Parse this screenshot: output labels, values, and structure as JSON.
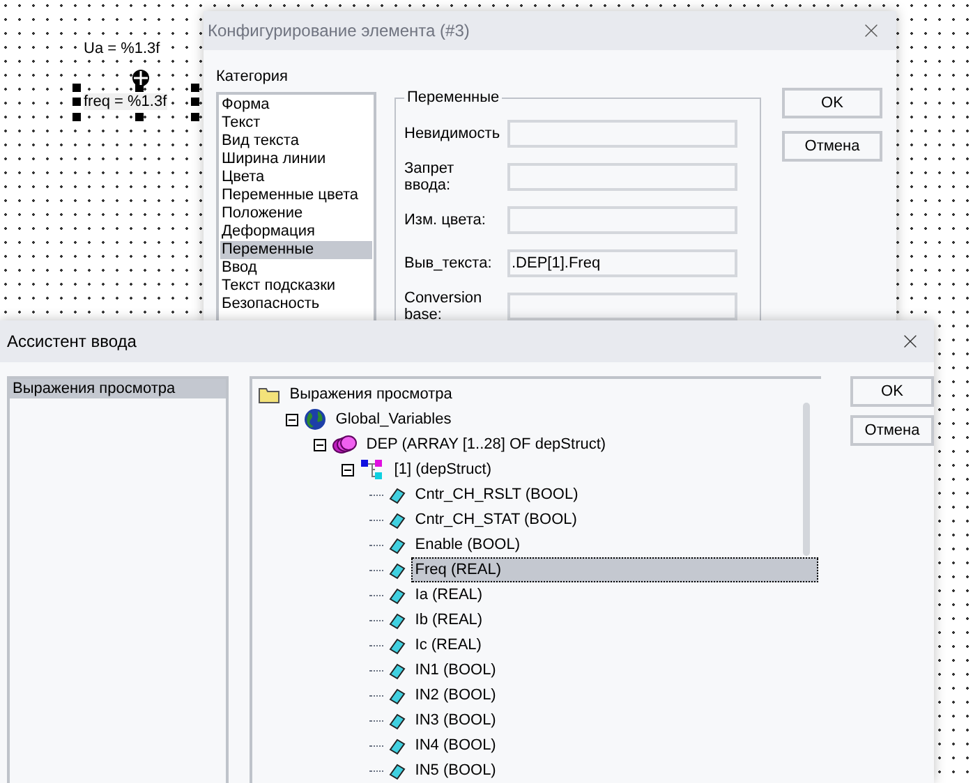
{
  "canvas": {
    "labels": [
      {
        "text": "Ua = %1.3f",
        "selected": false
      },
      {
        "text": "freq = %1.3f",
        "selected": true
      }
    ]
  },
  "config_dialog": {
    "title": "Конфигурирование элемента (#3)",
    "category_label": "Категория",
    "categories": [
      {
        "label": "Форма",
        "selected": false
      },
      {
        "label": "Текст",
        "selected": false
      },
      {
        "label": "Вид текста",
        "selected": false
      },
      {
        "label": "Ширина линии",
        "selected": false
      },
      {
        "label": "Цвета",
        "selected": false
      },
      {
        "label": "Переменные цвета",
        "selected": false
      },
      {
        "label": "Положение",
        "selected": false
      },
      {
        "label": "Деформация",
        "selected": false
      },
      {
        "label": "Переменные",
        "selected": true
      },
      {
        "label": "Ввод",
        "selected": false
      },
      {
        "label": "Текст подсказки",
        "selected": false
      },
      {
        "label": "Безопасность",
        "selected": false
      }
    ],
    "group_title": "Переменные",
    "fields": [
      {
        "label": "Невидимость"
      },
      {
        "label": "Запрет ввода:"
      },
      {
        "label": "Изм. цвета:"
      },
      {
        "label": "Выв_текста:",
        "value": ".DEP[1].Freq"
      },
      {
        "label": "Conversion base:"
      }
    ],
    "buttons": [
      "OK",
      "Отмена"
    ]
  },
  "input_assistant": {
    "title": "Ассистент ввода",
    "categories": [
      {
        "label": "Выражения просмотра",
        "selected": true
      }
    ],
    "tree": [
      {
        "label": "Выражения просмотра",
        "kind": "folder",
        "selected": false,
        "children": [
          {
            "label": "Global_Variables",
            "kind": "globe",
            "expanded": true,
            "selected": false,
            "children": [
              {
                "label": "DEP (ARRAY [1..28] OF depStruct)",
                "kind": "array",
                "expanded": true,
                "selected": false,
                "children": [
                  {
                    "label": "[1] (depStruct)",
                    "kind": "struct",
                    "expanded": true,
                    "selected": false,
                    "children": [
                      {
                        "label": "Cntr_CH_RSLT (BOOL)",
                        "kind": "variable",
                        "selected": false
                      },
                      {
                        "label": "Cntr_CH_STAT (BOOL)",
                        "kind": "variable",
                        "selected": false
                      },
                      {
                        "label": "Enable (BOOL)",
                        "kind": "variable",
                        "selected": false
                      },
                      {
                        "label": "Freq (REAL)",
                        "kind": "variable",
                        "selected": true
                      },
                      {
                        "label": "Ia (REAL)",
                        "kind": "variable",
                        "selected": false
                      },
                      {
                        "label": "Ib (REAL)",
                        "kind": "variable",
                        "selected": false
                      },
                      {
                        "label": "Ic (REAL)",
                        "kind": "variable",
                        "selected": false
                      },
                      {
                        "label": "IN1 (BOOL)",
                        "kind": "variable",
                        "selected": false
                      },
                      {
                        "label": "IN2 (BOOL)",
                        "kind": "variable",
                        "selected": false
                      },
                      {
                        "label": "IN3 (BOOL)",
                        "kind": "variable",
                        "selected": false
                      },
                      {
                        "label": "IN4 (BOOL)",
                        "kind": "variable",
                        "selected": false
                      },
                      {
                        "label": "IN5 (BOOL)",
                        "kind": "variable",
                        "selected": false
                      }
                    ]
                  }
                ]
              }
            ]
          }
        ]
      }
    ],
    "buttons": [
      "OK",
      "Отмена"
    ]
  }
}
